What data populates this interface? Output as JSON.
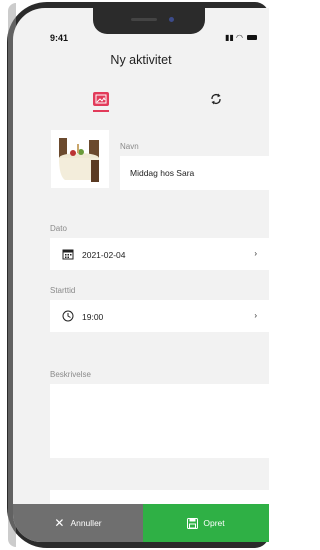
{
  "status": {
    "time": "9:41"
  },
  "header": {
    "title": "Ny aktivitet"
  },
  "form": {
    "name_label": "Navn",
    "name_value": "Middag hos Sara",
    "date_label": "Dato",
    "date_value": "2021-02-04",
    "start_label": "Starttid",
    "start_value": "19:00",
    "desc_label": "Beskrivelse"
  },
  "actions": {
    "cancel": "Annuller",
    "save": "Opret"
  },
  "colors": {
    "accent": "#e23b5a",
    "save": "#2fb045",
    "cancel": "#6f6f6f"
  },
  "icons": [
    "image-icon",
    "repeat-icon",
    "calendar-icon",
    "clock-icon",
    "chevron-right-icon",
    "close-icon",
    "save-icon"
  ]
}
